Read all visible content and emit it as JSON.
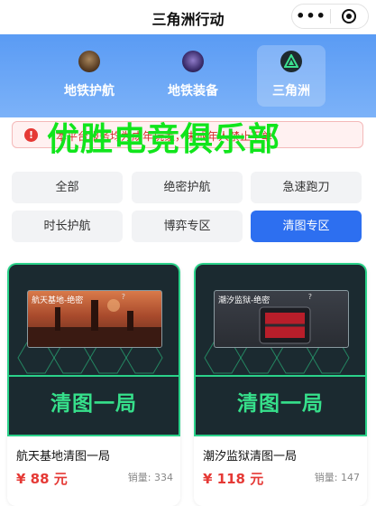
{
  "app": {
    "title": "三角洲行动",
    "more_glyph": "•••"
  },
  "categories": [
    {
      "label": "地铁护航",
      "icon": "soldier-avatar-icon"
    },
    {
      "label": "地铁装备",
      "icon": "mask-avatar-icon"
    },
    {
      "label": "三角洲",
      "icon": "delta-logo-icon",
      "selected": true
    }
  ],
  "notice": {
    "text": "本平台服务均为成年玩家，未成年人禁止下单"
  },
  "overlay_text": "优胜电竞俱乐部",
  "filters": [
    {
      "label": "全部",
      "active": false
    },
    {
      "label": "绝密护航",
      "active": false
    },
    {
      "label": "急速跑刀",
      "active": false
    },
    {
      "label": "时长护航",
      "active": false
    },
    {
      "label": "博弈专区",
      "active": false
    },
    {
      "label": "清图专区",
      "active": true
    }
  ],
  "products": [
    {
      "thumb_title": "航天基地-绝密",
      "thumb_question": "?",
      "banner": "清图一局",
      "name": "航天基地清图一局",
      "price": "¥ 88 元",
      "sales": "销量: 334"
    },
    {
      "thumb_title": "潮汐监狱-绝密",
      "thumb_question": "?",
      "banner": "清图一局",
      "name": "潮汐监狱清图一局",
      "price": "¥ 118 元",
      "sales": "销量: 147"
    }
  ],
  "colors": {
    "accent": "#2d6ff0",
    "header": "#5a9bf4",
    "price": "#e53935",
    "banner": "#36e08b",
    "overlay": "#11e51c"
  }
}
